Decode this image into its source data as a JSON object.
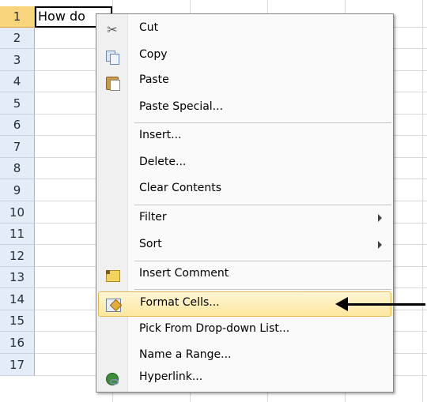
{
  "sheet": {
    "rows": [
      "1",
      "2",
      "3",
      "4",
      "5",
      "6",
      "7",
      "8",
      "9",
      "10",
      "11",
      "12",
      "13",
      "14",
      "15",
      "16",
      "17"
    ],
    "active_cell_text": "How do"
  },
  "menu": {
    "items": [
      {
        "label": "Cut",
        "icon": "scissors-icon"
      },
      {
        "label": "Copy",
        "icon": "copy-icon"
      },
      {
        "label": "Paste",
        "icon": "paste-icon"
      },
      {
        "label": "Paste Special..."
      },
      {
        "label": "Insert..."
      },
      {
        "label": "Delete..."
      },
      {
        "label": "Clear Contents"
      },
      {
        "label": "Filter",
        "submenu": true
      },
      {
        "label": "Sort",
        "submenu": true
      },
      {
        "label": "Insert Comment",
        "icon": "comment-icon"
      },
      {
        "label": "Format Cells...",
        "icon": "format-cells-icon",
        "highlighted": true
      },
      {
        "label": "Pick From Drop-down List..."
      },
      {
        "label": "Name a Range..."
      },
      {
        "label": "Hyperlink...",
        "icon": "hyperlink-icon"
      }
    ]
  },
  "annotation": {
    "type": "arrow",
    "points_to": "Format Cells..."
  }
}
